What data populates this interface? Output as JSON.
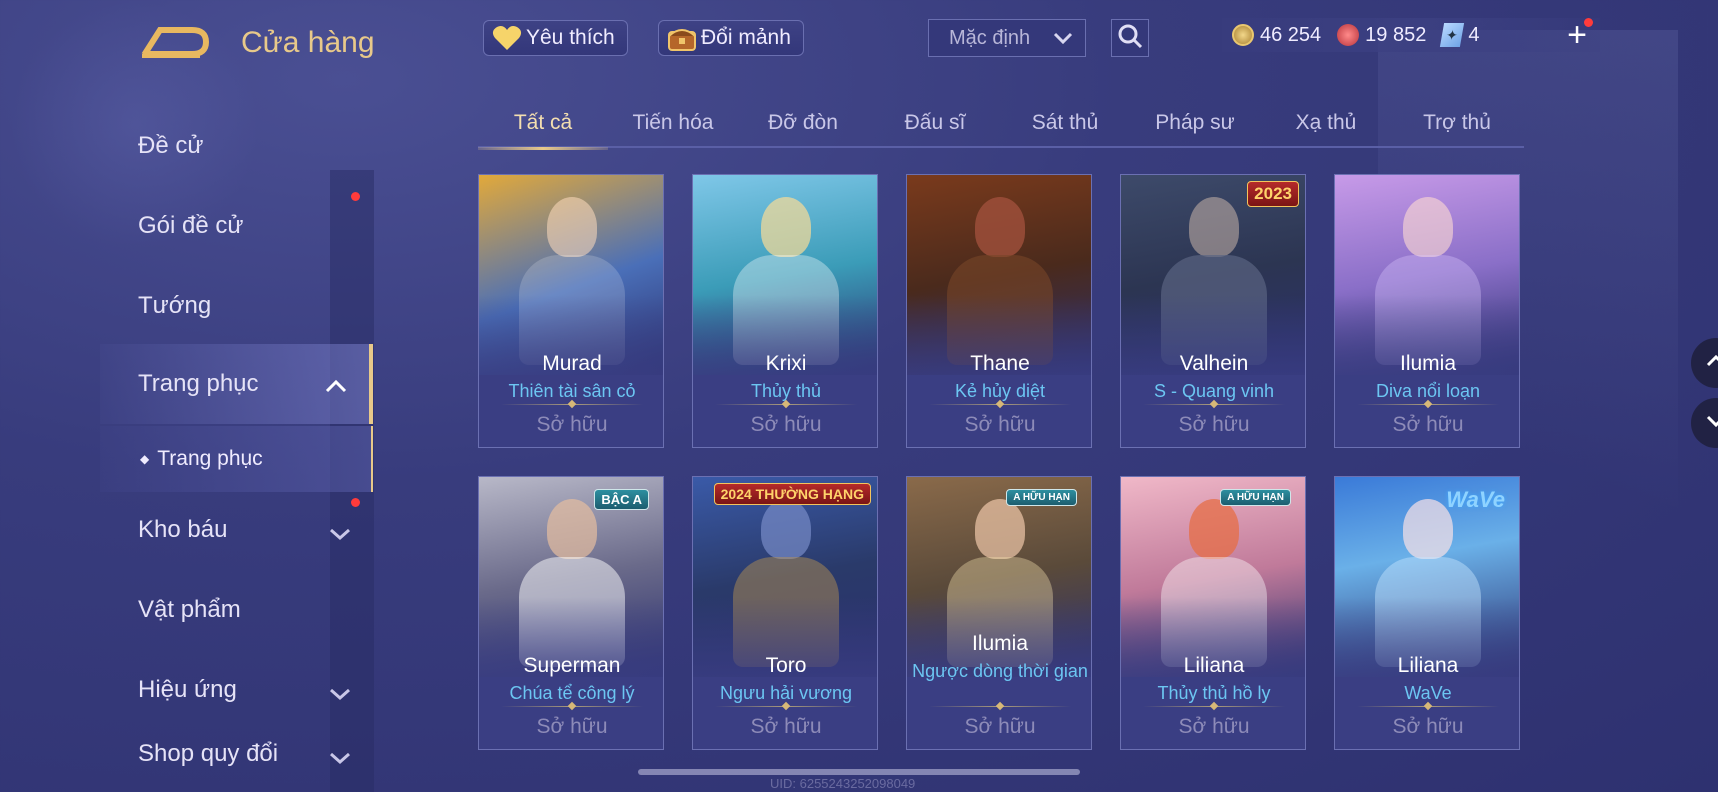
{
  "header": {
    "title": "Cửa hàng",
    "favorite_label": "Yêu thích",
    "exchange_label": "Đổi mảnh",
    "sort_selected": "Mặc định",
    "currencies": [
      {
        "icon": "gold-coin-icon",
        "value": "46 254"
      },
      {
        "icon": "voucher-icon",
        "value": "19 852"
      },
      {
        "icon": "token-icon",
        "value": "4"
      }
    ]
  },
  "sidebar": {
    "items": [
      {
        "label": "Đề cử"
      },
      {
        "label": "Gói đề cử"
      },
      {
        "label": "Tướng"
      },
      {
        "label": "Trang phục"
      },
      {
        "label": "Kho báu"
      },
      {
        "label": "Vật phẩm"
      },
      {
        "label": "Hiệu ứng"
      },
      {
        "label": "Shop quy đổi"
      }
    ],
    "sub_item": "Trang phục"
  },
  "tabs": [
    "Tất cả",
    "Tiến hóa",
    "Đỡ đòn",
    "Đấu sĩ",
    "Sát thủ",
    "Pháp sư",
    "Xạ thủ",
    "Trợ thủ"
  ],
  "cards": [
    {
      "hero": "Murad",
      "skin": "Thiên tài sân cỏ",
      "status": "Sở hữu",
      "badge": ""
    },
    {
      "hero": "Krixi",
      "skin": "Thủy thủ",
      "status": "Sở hữu",
      "badge": ""
    },
    {
      "hero": "Thane",
      "skin": "Kẻ hủy diệt",
      "status": "Sở hữu",
      "badge": ""
    },
    {
      "hero": "Valhein",
      "skin": "S - Quang vinh",
      "status": "Sở hữu",
      "badge": "2023"
    },
    {
      "hero": "Ilumia",
      "skin": "Diva nổi loạn",
      "status": "Sở hữu",
      "badge": ""
    },
    {
      "hero": "Superman",
      "skin": "Chúa tể công lý",
      "status": "Sở hữu",
      "badge": "BẬC A"
    },
    {
      "hero": "Toro",
      "skin": "Ngưu hải vương",
      "status": "Sở hữu",
      "badge": "2024 THƯỜNG HẠNG"
    },
    {
      "hero": "Ilumia",
      "skin": "Ngược dòng thời gian",
      "status": "Sở hữu",
      "badge": "A HỮU HẠN"
    },
    {
      "hero": "Liliana",
      "skin": "Thủy thủ hồ ly",
      "status": "Sở hữu",
      "badge": "A HỮU HẠN"
    },
    {
      "hero": "Liliana",
      "skin": "WaVe",
      "status": "Sở hữu",
      "badge": "WaVe"
    }
  ],
  "uid": "UID: 6255243252098049",
  "colors": {
    "accent": "#e8c98a",
    "skin_text": "#6cc6f2",
    "badge_dot": "#ff3b3b"
  }
}
